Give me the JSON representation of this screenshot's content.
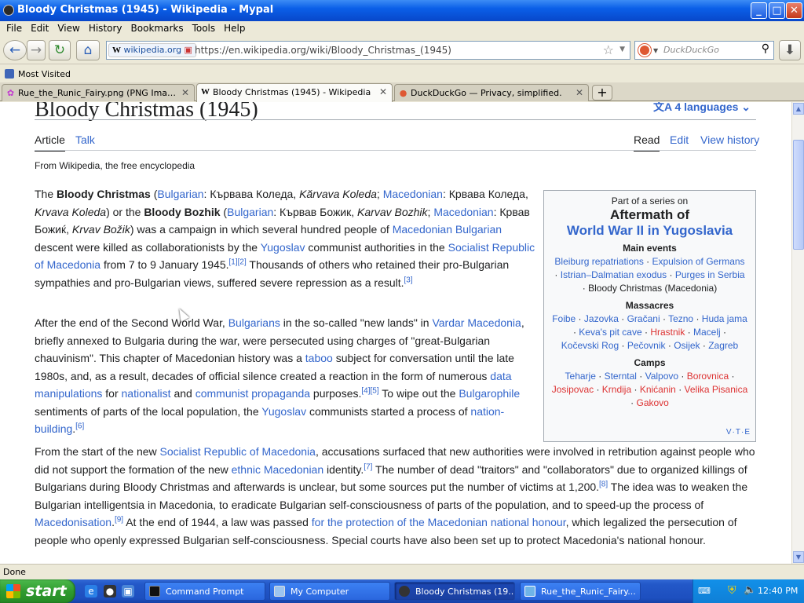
{
  "window": {
    "title": "Bloody Christmas (1945) - Wikipedia - Mypal",
    "buttons": {
      "minimize": "_",
      "maximize": "□",
      "close": "✕"
    }
  },
  "menu": [
    "File",
    "Edit",
    "View",
    "History",
    "Bookmarks",
    "Tools",
    "Help"
  ],
  "nav": {
    "site_label": "wikipedia.org",
    "url": "https://en.wikipedia.org/wiki/Bloody_Christmas_(1945)",
    "search_placeholder": "DuckDuckGo"
  },
  "bookmarks": {
    "item": "Most Visited"
  },
  "tabs": [
    {
      "label": "Rue_the_Runic_Fairy.png (PNG Image, 1...",
      "icon": "fairy-image-icon",
      "active": false
    },
    {
      "label": "Bloody Christmas (1945) - Wikipedia",
      "icon": "wikipedia-icon",
      "active": true
    },
    {
      "label": "DuckDuckGo — Privacy, simplified.",
      "icon": "duckduckgo-icon",
      "active": false
    }
  ],
  "page": {
    "title": "Bloody Christmas (1945)",
    "languages": "4 languages",
    "tabs_left": [
      "Article",
      "Talk"
    ],
    "tabs_right": [
      "Read",
      "Edit",
      "View history"
    ],
    "tagline": "From Wikipedia, the free encyclopedia"
  },
  "infobox": {
    "part_of": "Part of a series on",
    "title1": "Aftermath of",
    "title2": "World War II in Yugoslavia",
    "main_events_header": "Main events",
    "main_events": [
      "Bleiburg repatriations",
      "Expulsion of Germans",
      "Istrian–Dalmatian exodus",
      "Purges in Serbia"
    ],
    "current": "Bloody Christmas (Macedonia)",
    "massacres_header": "Massacres",
    "massacres": [
      "Foibe",
      "Jazovka",
      "Gračani",
      "Tezno",
      "Huda jama",
      "Keva's pit cave",
      "Hrastnik",
      "Macelj",
      "Kočevski Rog",
      "Pečovnik",
      "Osijek",
      "Zagreb"
    ],
    "camps_header": "Camps",
    "camps": [
      "Teharje",
      "Sterntal",
      "Valpovo",
      "Borovnica",
      "Josipovac",
      "Krndija",
      "Knićanin",
      "Velika Pisanica",
      "Gakovo"
    ],
    "vte": "V·T·E"
  },
  "status": "Done",
  "taskbar": {
    "start": "start",
    "tasks": [
      "Command Prompt",
      "My Computer",
      "Bloody Christmas (19...",
      "Rue_the_Runic_Fairy..."
    ],
    "clock": "12:40 PM"
  },
  "colors": {
    "link": "#3366cc",
    "redlink": "#d33",
    "xp_blue": "#245edb",
    "start_green": "#2f9b2f"
  }
}
